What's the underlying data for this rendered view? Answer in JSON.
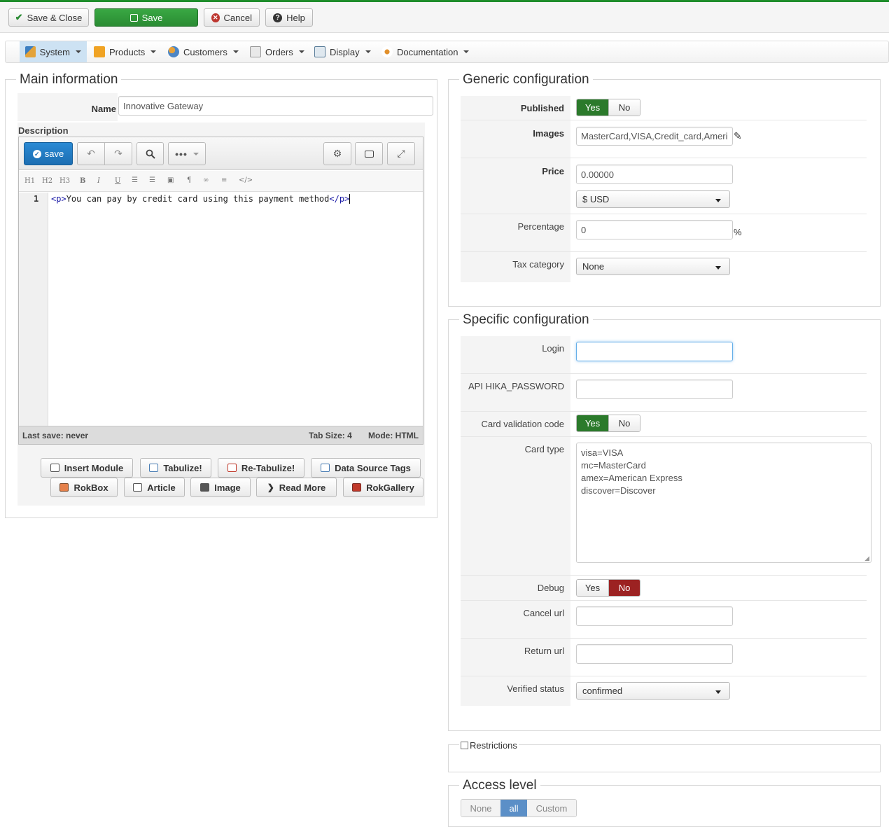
{
  "toolbar": {
    "save_close": "Save & Close",
    "save": "Save",
    "cancel": "Cancel",
    "help": "Help"
  },
  "menu": [
    {
      "label": "System",
      "icon": "tools-icon"
    },
    {
      "label": "Products",
      "icon": "box-icon"
    },
    {
      "label": "Customers",
      "icon": "users-icon"
    },
    {
      "label": "Orders",
      "icon": "orders-icon"
    },
    {
      "label": "Display",
      "icon": "display-icon"
    },
    {
      "label": "Documentation",
      "icon": "documentation-icon"
    }
  ],
  "main": {
    "legend": "Main information",
    "name_label": "Name",
    "name_value": "Innovative Gateway",
    "description_label": "Description",
    "editor": {
      "save_label": "save",
      "headings": [
        "H1",
        "H2",
        "H3",
        "B",
        "I",
        "U"
      ],
      "line_number": "1",
      "code_open": "<p>",
      "code_text": "You can pay by credit card using this payment method",
      "code_close": "</p>",
      "status_left": "Last save: never",
      "status_tab": "Tab Size: 4",
      "status_mode": "Mode: HTML"
    },
    "plugin_buttons": [
      "Insert Module",
      "Tabulize!",
      "Re-Tabulize!",
      "Data Source Tags",
      "RokBox",
      "Article",
      "Image",
      "Read More",
      "RokGallery"
    ]
  },
  "generic": {
    "legend": "Generic configuration",
    "published_label": "Published",
    "yes": "Yes",
    "no": "No",
    "images_label": "Images",
    "images_value": "MasterCard,VISA,Credit_card,Ameri",
    "price_label": "Price",
    "price_value": "0.00000",
    "currency_value": "$ USD",
    "percentage_label": "Percentage",
    "percentage_value": "0",
    "percent_sign": "%",
    "tax_label": "Tax category",
    "tax_value": "None"
  },
  "specific": {
    "legend": "Specific configuration",
    "login_label": "Login",
    "login_value": "",
    "password_label": "API HIKA_PASSWORD",
    "password_value": "",
    "cvc_label": "Card validation code",
    "card_type_label": "Card type",
    "card_types": [
      "visa=VISA",
      "mc=MasterCard",
      "amex=American Express",
      "discover=Discover"
    ],
    "debug_label": "Debug",
    "cancel_url_label": "Cancel url",
    "return_url_label": "Return url",
    "verified_label": "Verified status",
    "verified_value": "confirmed"
  },
  "restrictions": {
    "label": "Restrictions"
  },
  "access": {
    "legend": "Access level",
    "options": [
      "None",
      "all",
      "Custom"
    ]
  }
}
